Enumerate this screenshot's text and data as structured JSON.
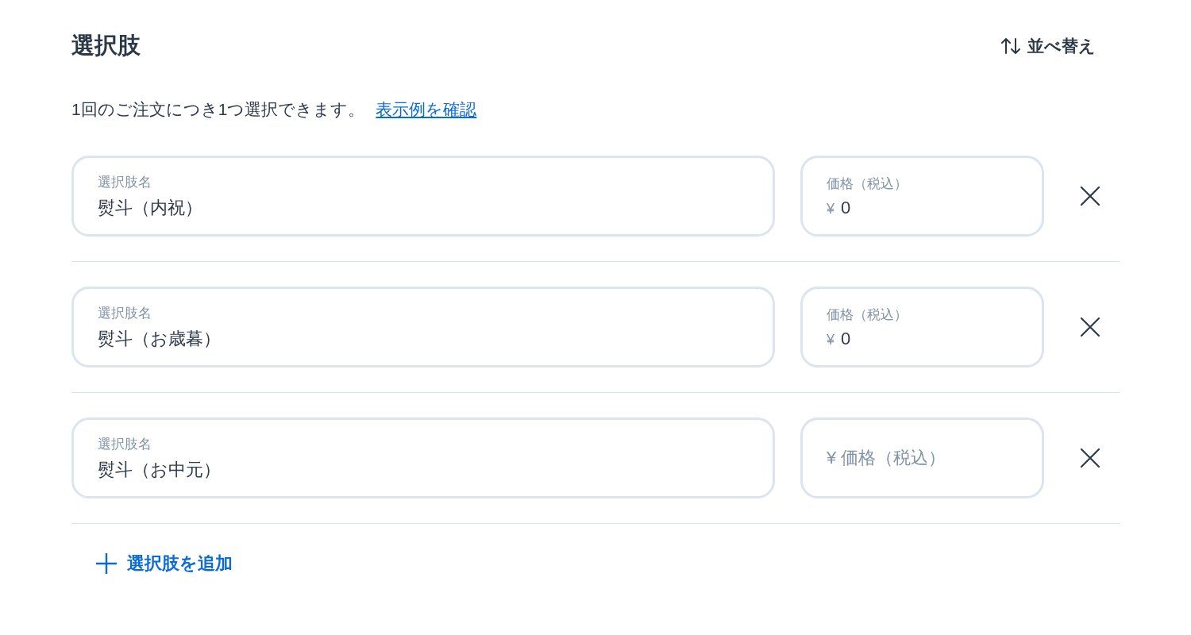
{
  "header": {
    "title": "選択肢",
    "sort_button": "並べ替え"
  },
  "description": {
    "text": "1回のご注文につき1つ選択できます。",
    "link": "表示例を確認"
  },
  "options": [
    {
      "name_field": {
        "label": "選択肢名",
        "value": "熨斗（内祝）"
      },
      "price_field": {
        "label": "価格（税込）",
        "currency": "¥",
        "value": "0"
      }
    },
    {
      "name_field": {
        "label": "選択肢名",
        "value": "熨斗（お歳暮）"
      },
      "price_field": {
        "label": "価格（税込）",
        "currency": "¥",
        "value": "0"
      }
    },
    {
      "name_field": {
        "label": "選択肢名",
        "value": "熨斗（お中元）"
      },
      "price_field": {
        "placeholder": "¥ 価格（税込）"
      }
    }
  ],
  "add_button": "選択肢を追加"
}
